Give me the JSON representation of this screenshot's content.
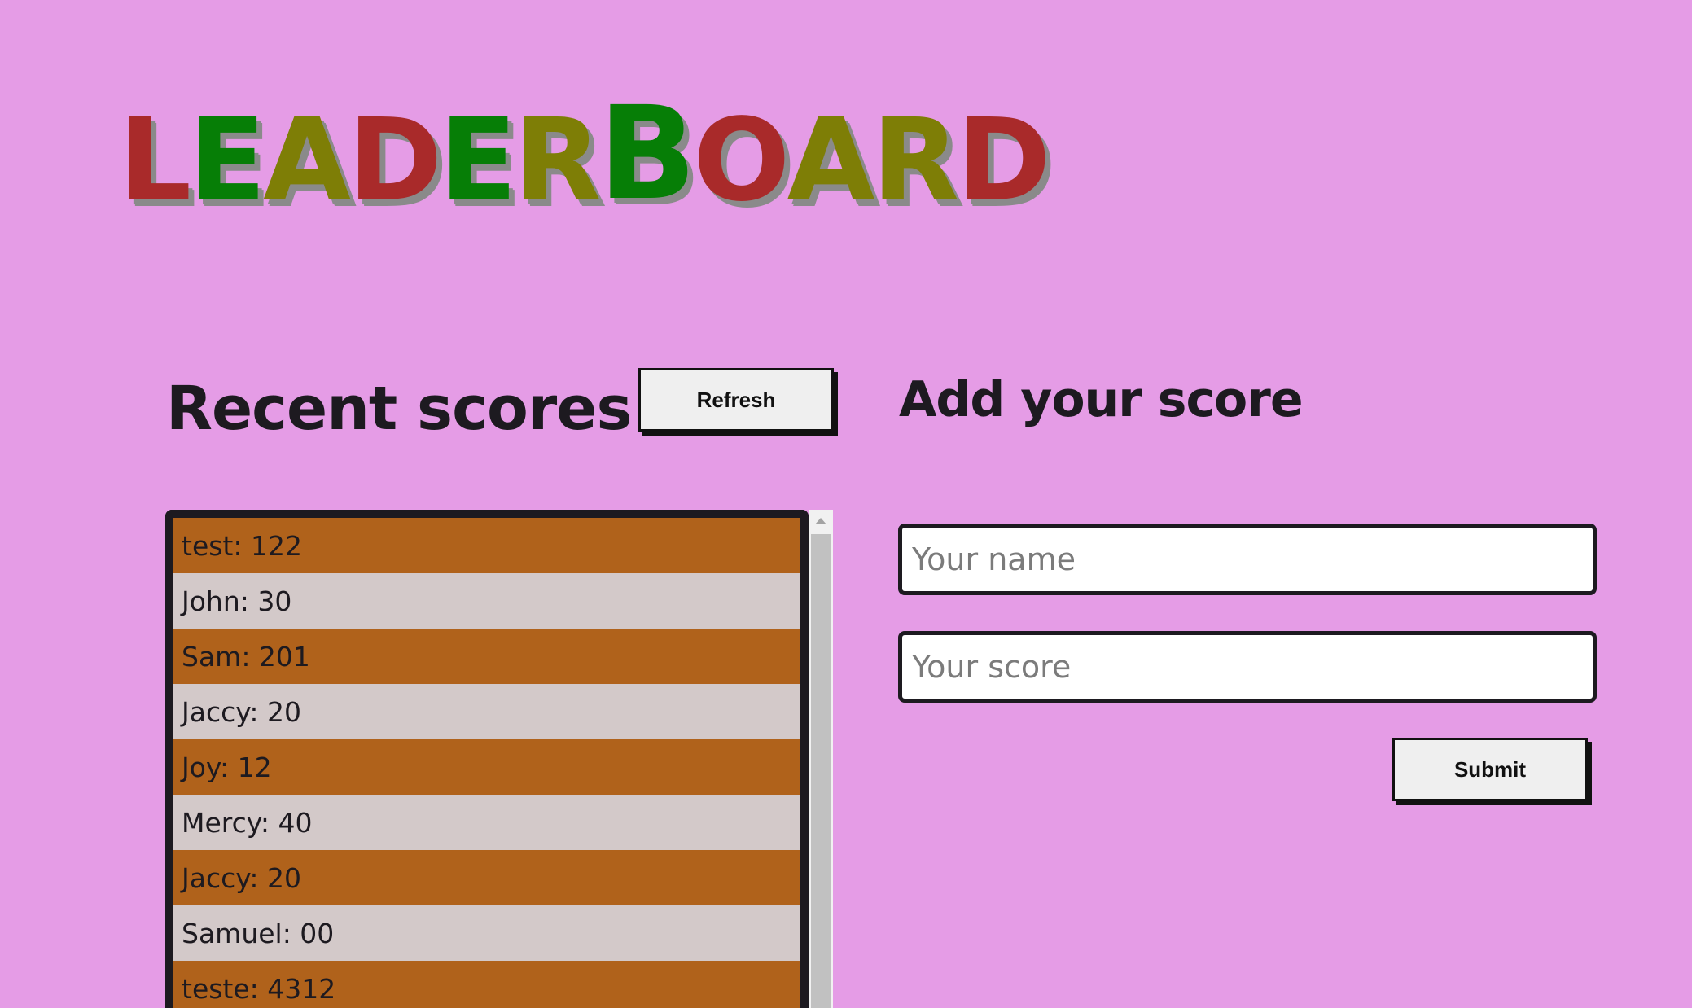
{
  "logo": {
    "letters": [
      {
        "char": "L",
        "color": "#a92a2a",
        "size": "small"
      },
      {
        "char": "E",
        "color": "#067e06",
        "size": "small"
      },
      {
        "char": "A",
        "color": "#7e7e06",
        "size": "small"
      },
      {
        "char": "D",
        "color": "#a92a2a",
        "size": "small"
      },
      {
        "char": "E",
        "color": "#067e06",
        "size": "small"
      },
      {
        "char": "R",
        "color": "#7e7e06",
        "size": "small"
      },
      {
        "char": "B",
        "color": "#067e06",
        "size": "big"
      },
      {
        "char": "O",
        "color": "#a92a2a",
        "size": "small"
      },
      {
        "char": "A",
        "color": "#7e7e06",
        "size": "small"
      },
      {
        "char": "R",
        "color": "#7e7e06",
        "size": "small"
      },
      {
        "char": "D",
        "color": "#a92a2a",
        "size": "small"
      }
    ],
    "shadow_color": "#8a8a8a"
  },
  "recent": {
    "heading": "Recent scores",
    "refresh_label": "Refresh",
    "scores": [
      "test: 122",
      "John: 30",
      "Sam: 201",
      "Jaccy: 20",
      "Joy: 12",
      "Mercy: 40",
      "Jaccy: 20",
      "Samuel: 00",
      "teste: 4312"
    ]
  },
  "add": {
    "heading": "Add your score",
    "name_placeholder": "Your name",
    "name_value": "",
    "score_placeholder": "Your score",
    "score_value": "",
    "submit_label": "Submit"
  },
  "colors": {
    "background": "#e59ce6",
    "row_odd": "#b0621b",
    "row_even": "#d3c9c9",
    "text_dark": "#1d1a20"
  }
}
